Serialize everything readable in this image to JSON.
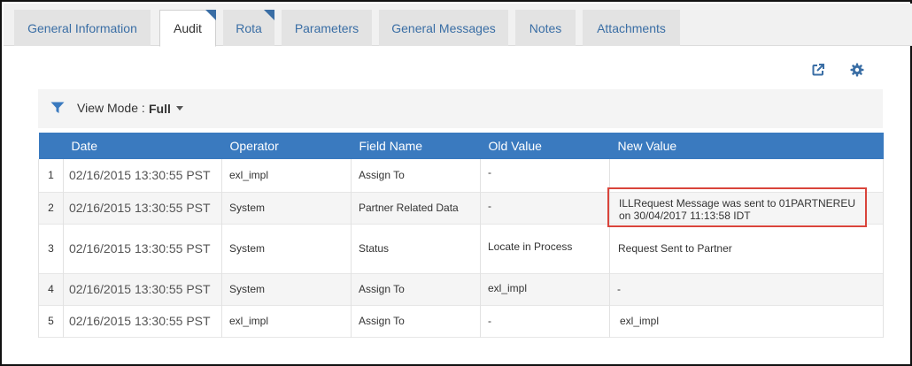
{
  "tabs": [
    {
      "label": "General Information",
      "active": false,
      "flagged": false
    },
    {
      "label": "Audit",
      "active": true,
      "flagged": true
    },
    {
      "label": "Rota",
      "active": false,
      "flagged": true
    },
    {
      "label": "Parameters",
      "active": false,
      "flagged": false
    },
    {
      "label": "General Messages",
      "active": false,
      "flagged": false
    },
    {
      "label": "Notes",
      "active": false,
      "flagged": false
    },
    {
      "label": "Attachments",
      "active": false,
      "flagged": false
    }
  ],
  "toolbar": {
    "view_mode_label": "View Mode :",
    "view_mode_value": "Full",
    "icons": [
      "filter-icon",
      "external-link-icon",
      "gear-icon"
    ]
  },
  "table": {
    "columns": [
      "Date",
      "Operator",
      "Field Name",
      "Old Value",
      "New Value"
    ],
    "rows": [
      {
        "num": "1",
        "date": "02/16/2015 13:30:55 PST",
        "operator": "exl_impl",
        "field": "Assign To",
        "old": "-",
        "new_1": "",
        "new_2": ""
      },
      {
        "num": "2",
        "date": "02/16/2015 13:30:55 PST",
        "operator": "System",
        "field": "Partner Related Data",
        "old": "-",
        "new_1": "ILLRequest Message was sent to 01PARTNEREU",
        "new_2": "on 30/04/2017 11:13:58 IDT"
      },
      {
        "num": "3",
        "date": "02/16/2015 13:30:55 PST",
        "operator": "System",
        "field": "Status",
        "old": "Locate in Process",
        "new_1": "Request Sent to Partner",
        "new_2": ""
      },
      {
        "num": "4",
        "date": "02/16/2015 13:30:55 PST",
        "operator": "System",
        "field": "Assign To",
        "old": "exl_impl",
        "new_1": "-",
        "new_2": ""
      },
      {
        "num": "5",
        "date": "02/16/2015 13:30:55 PST",
        "operator": "exl_impl",
        "field": "Assign To",
        "old": "-",
        "new_1": "exl_impl",
        "new_2": ""
      }
    ]
  },
  "colors": {
    "accent": "#3a7abf",
    "link": "#3a6ea5",
    "highlight_border": "#d9443b"
  }
}
